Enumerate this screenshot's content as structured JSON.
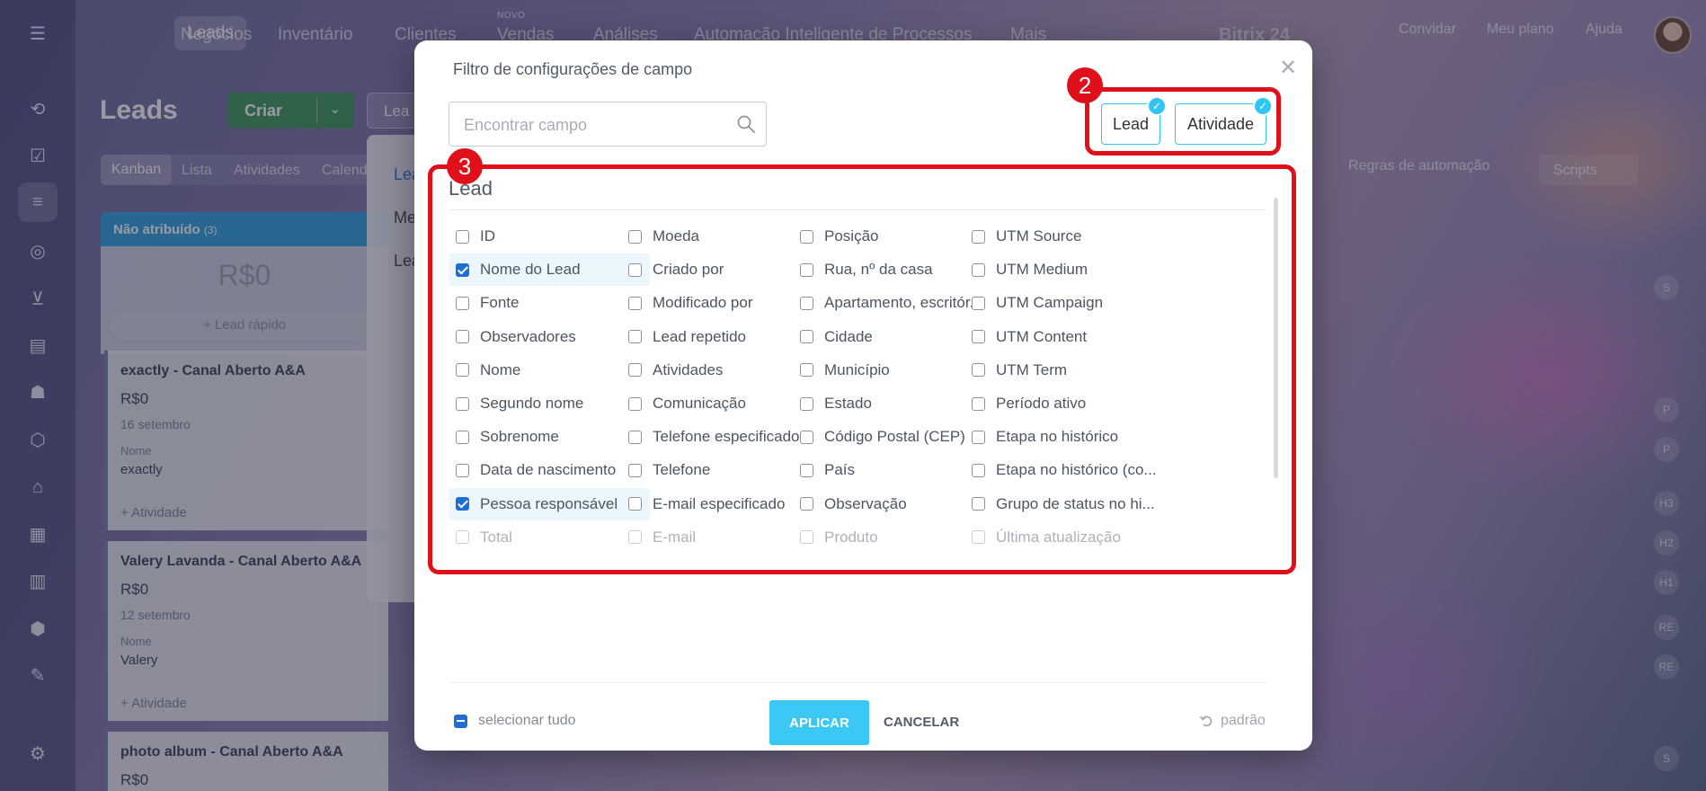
{
  "topnav": {
    "items": [
      "Leads",
      "Negócios",
      "Inventário",
      "Clientes",
      "Vendas",
      "Análises",
      "Automação Inteligente de Processos",
      "Mais"
    ],
    "new_badge": "NOVO",
    "brand": "Bitrix 24",
    "buttons": [
      "Convidar",
      "Meu plano",
      "Ajuda"
    ]
  },
  "page": {
    "title": "Leads",
    "create_label": "Criar",
    "leads_tab_label": "Lea",
    "view_tabs": [
      "Kanban",
      "Lista",
      "Atividades",
      "Calend"
    ],
    "automation_rules": "Regras de automação",
    "scripts": "Scripts"
  },
  "kanban": {
    "column_title": "Não atribuído",
    "column_count": "(3)",
    "column_sum": "R$0",
    "quick_lead": "Lead rápido",
    "cards": [
      {
        "title": "exactly - Canal Aberto A&A",
        "amount": "R$0",
        "date": "16 setembro",
        "field_label": "Nome",
        "field_value": "exactly",
        "activity": "+ Atividade"
      },
      {
        "title": "Valery Lavanda - Canal Aberto A&A",
        "amount": "R$0",
        "date": "12 setembro",
        "field_label": "Nome",
        "field_value": "Valery",
        "activity": "+ Atividade"
      },
      {
        "title": "photo album - Canal Aberto A&A",
        "amount": "R$0"
      }
    ]
  },
  "dropdown": {
    "items": [
      "Lea",
      "Me",
      "Lea"
    ]
  },
  "rightrail": {
    "items": [
      "S",
      "P",
      "P",
      "H3",
      "H2",
      "H1",
      "RE",
      "RE",
      "S"
    ]
  },
  "modal": {
    "title": "Filtro de configurações de campo",
    "search_placeholder": "Encontrar campo",
    "tags": [
      "Lead",
      "Atividade"
    ],
    "annotation_2": "2",
    "annotation_3": "3",
    "section_title": "Lead",
    "columns": [
      [
        {
          "label": "ID",
          "checked": false
        },
        {
          "label": "Nome do Lead",
          "checked": true
        },
        {
          "label": "Fonte",
          "checked": false
        },
        {
          "label": "Observadores",
          "checked": false
        },
        {
          "label": "Nome",
          "checked": false
        },
        {
          "label": "Segundo nome",
          "checked": false
        },
        {
          "label": "Sobrenome",
          "checked": false
        },
        {
          "label": "Data de nascimento",
          "checked": false
        },
        {
          "label": "Pessoa responsável",
          "checked": true
        },
        {
          "label": "Total",
          "checked": false
        }
      ],
      [
        {
          "label": "Moeda",
          "checked": false
        },
        {
          "label": "Criado por",
          "checked": false
        },
        {
          "label": "Modificado por",
          "checked": false
        },
        {
          "label": "Lead repetido",
          "checked": false
        },
        {
          "label": "Atividades",
          "checked": false
        },
        {
          "label": "Comunicação",
          "checked": false
        },
        {
          "label": "Telefone especificado",
          "checked": false
        },
        {
          "label": "Telefone",
          "checked": false
        },
        {
          "label": "E-mail especificado",
          "checked": false
        },
        {
          "label": "E-mail",
          "checked": false
        }
      ],
      [
        {
          "label": "Posição",
          "checked": false
        },
        {
          "label": "Rua, nº da casa",
          "checked": false
        },
        {
          "label": "Apartamento, escritór...",
          "checked": false
        },
        {
          "label": "Cidade",
          "checked": false
        },
        {
          "label": "Município",
          "checked": false
        },
        {
          "label": "Estado",
          "checked": false
        },
        {
          "label": "Código Postal (CEP)",
          "checked": false
        },
        {
          "label": "País",
          "checked": false
        },
        {
          "label": "Observação",
          "checked": false
        },
        {
          "label": "Produto",
          "checked": false
        }
      ],
      [
        {
          "label": "UTM Source",
          "checked": false
        },
        {
          "label": "UTM Medium",
          "checked": false
        },
        {
          "label": "UTM Campaign",
          "checked": false
        },
        {
          "label": "UTM Content",
          "checked": false
        },
        {
          "label": "UTM Term",
          "checked": false
        },
        {
          "label": "Período ativo",
          "checked": false
        },
        {
          "label": "Etapa no histórico",
          "checked": false
        },
        {
          "label": "Etapa no histórico (co...",
          "checked": false
        },
        {
          "label": "Grupo de status no hi...",
          "checked": false
        },
        {
          "label": "Última atualização",
          "checked": false
        }
      ]
    ],
    "select_all": "selecionar tudo",
    "apply": "APLICAR",
    "cancel": "CANCELAR",
    "default": "padrão"
  },
  "colors": {
    "accent": "#2fc6f6",
    "apply": "#3bc8f5",
    "annotation": "#e0101b",
    "checkbox": "#1e6fd1"
  }
}
